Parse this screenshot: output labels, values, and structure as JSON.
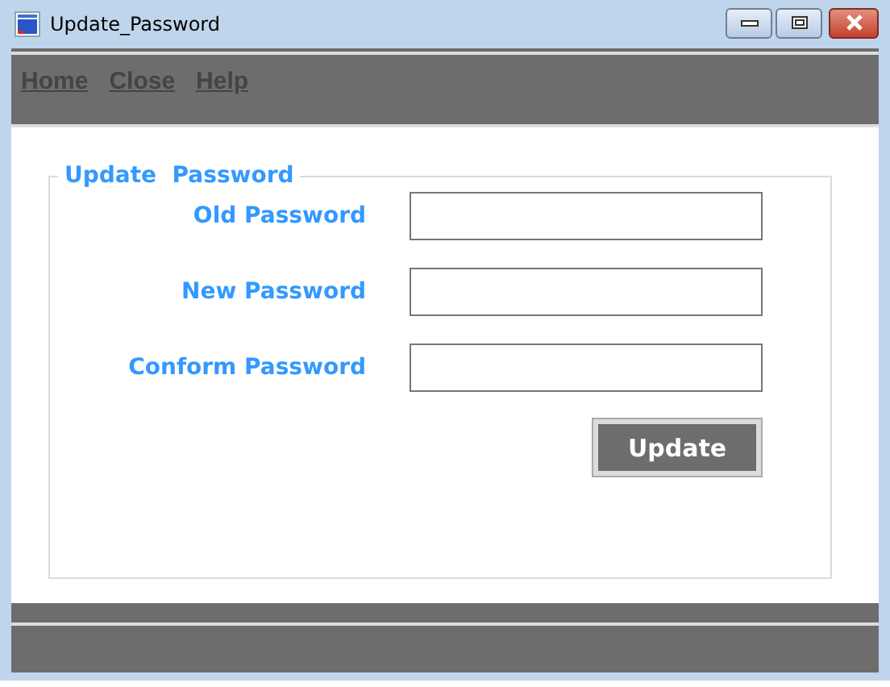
{
  "window": {
    "title": "Update_Password"
  },
  "menu": [
    {
      "label": "Home"
    },
    {
      "label": "Close"
    },
    {
      "label": "Help"
    }
  ],
  "form": {
    "title": "Update  Password",
    "fields": [
      {
        "label": "Old Password"
      },
      {
        "label": "New Password"
      },
      {
        "label": "Conform Password"
      }
    ],
    "button": "Update"
  }
}
